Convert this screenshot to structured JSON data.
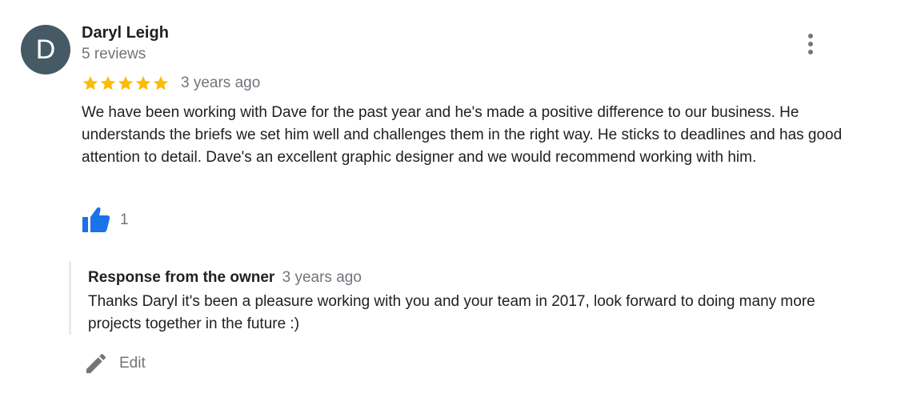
{
  "review": {
    "avatar_letter": "D",
    "reviewer_name": "Daryl Leigh",
    "review_count": "5 reviews",
    "rating": 5,
    "star_color": "#fbbc04",
    "date": "3 years ago",
    "text": "We have been working with Dave for the past year and he's made a positive difference to our business. He understands the briefs we set him well and challenges them in the right way. He sticks to deadlines and has good attention to detail. Dave's an excellent graphic designer and we would recommend working with him.",
    "like_count": "1",
    "like_icon_color": "#1a73e8",
    "more_icon": "more-vert-icon"
  },
  "owner_response": {
    "title": "Response from the owner",
    "date": "3 years ago",
    "text": "Thanks Daryl it's been a pleasure working with you and your team in 2017, look forward to doing many more projects together in the future :)"
  },
  "actions": {
    "edit_label": "Edit",
    "edit_icon": "pencil-icon"
  }
}
